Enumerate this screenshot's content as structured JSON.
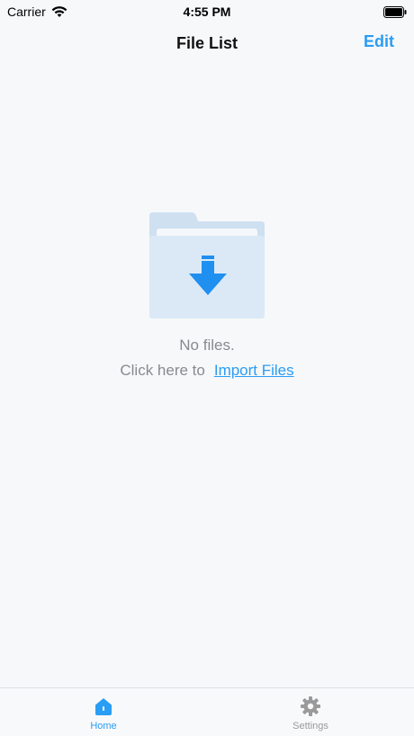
{
  "status_bar": {
    "carrier": "Carrier",
    "time": "4:55 PM"
  },
  "nav": {
    "title": "File List",
    "edit_label": "Edit"
  },
  "empty_state": {
    "message": "No files.",
    "prompt_text": "Click here to",
    "import_link": "Import Files",
    "icon": "folder-download-icon"
  },
  "tabs": [
    {
      "label": "Home",
      "icon": "home-icon",
      "active": true
    },
    {
      "label": "Settings",
      "icon": "gear-icon",
      "active": false
    }
  ],
  "colors": {
    "accent": "#2a9df4",
    "background": "#f6f8fa",
    "secondary_text": "#8a8a8e",
    "inactive_tab": "#999999"
  }
}
